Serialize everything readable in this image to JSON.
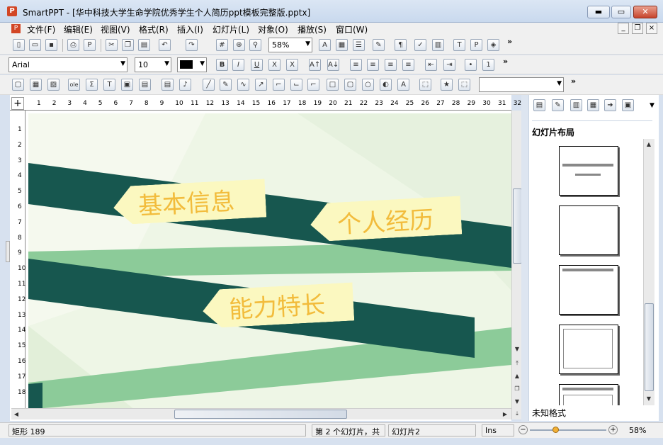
{
  "app": {
    "logo_letter": "P",
    "title": "SmartPPT - [华中科技大学生命学院优秀学生个人简历ppt模板完整版.pptx]"
  },
  "window_buttons": {
    "minimize": "▬",
    "maximize": "▭",
    "close": "✕"
  },
  "mdi_buttons": {
    "minimize": "_",
    "restore": "❐",
    "close": "×"
  },
  "menu": [
    "文件(F)",
    "编辑(E)",
    "视图(V)",
    "格式(R)",
    "插入(I)",
    "幻灯片(L)",
    "对象(O)",
    "播放(S)",
    "窗口(W)"
  ],
  "toolbar": {
    "zoom_value": "58%",
    "font_name": "Arial",
    "font_size": "10",
    "more": "»"
  },
  "ruler": {
    "h_ticks": [
      "1",
      "2",
      "3",
      "4",
      "5",
      "6",
      "7",
      "8",
      "9",
      "10",
      "11",
      "12",
      "13",
      "14",
      "15",
      "16",
      "17",
      "18",
      "19",
      "20",
      "21",
      "22",
      "23",
      "24",
      "25",
      "26",
      "27",
      "28",
      "29",
      "30",
      "31",
      "32"
    ],
    "v_ticks": [
      "1",
      "2",
      "3",
      "4",
      "5",
      "6",
      "7",
      "8",
      "9",
      "10",
      "11",
      "12",
      "13",
      "14",
      "15",
      "16",
      "17",
      "18"
    ]
  },
  "slide": {
    "label1": "基本信息",
    "label2": "个人经历",
    "label3": "能力特长",
    "colors": {
      "dark_band": "#17574f",
      "light_band": "#8ccb99",
      "tag_bg": "#fbf8c0",
      "tag_text": "#f2bc3c",
      "bg": "#eef6e6"
    }
  },
  "panel": {
    "title": "幻灯片布局",
    "caption": "未知格式",
    "layouts": [
      "title-slide",
      "blank",
      "title-only",
      "content-frame",
      "title-and-content"
    ]
  },
  "status": {
    "shape": "矩形 189",
    "slide_count": "第 2 个幻灯片，共",
    "slide_name": "幻灯片2",
    "mode": "Ins",
    "zoom": "58%",
    "zoom_level": 0.35
  }
}
